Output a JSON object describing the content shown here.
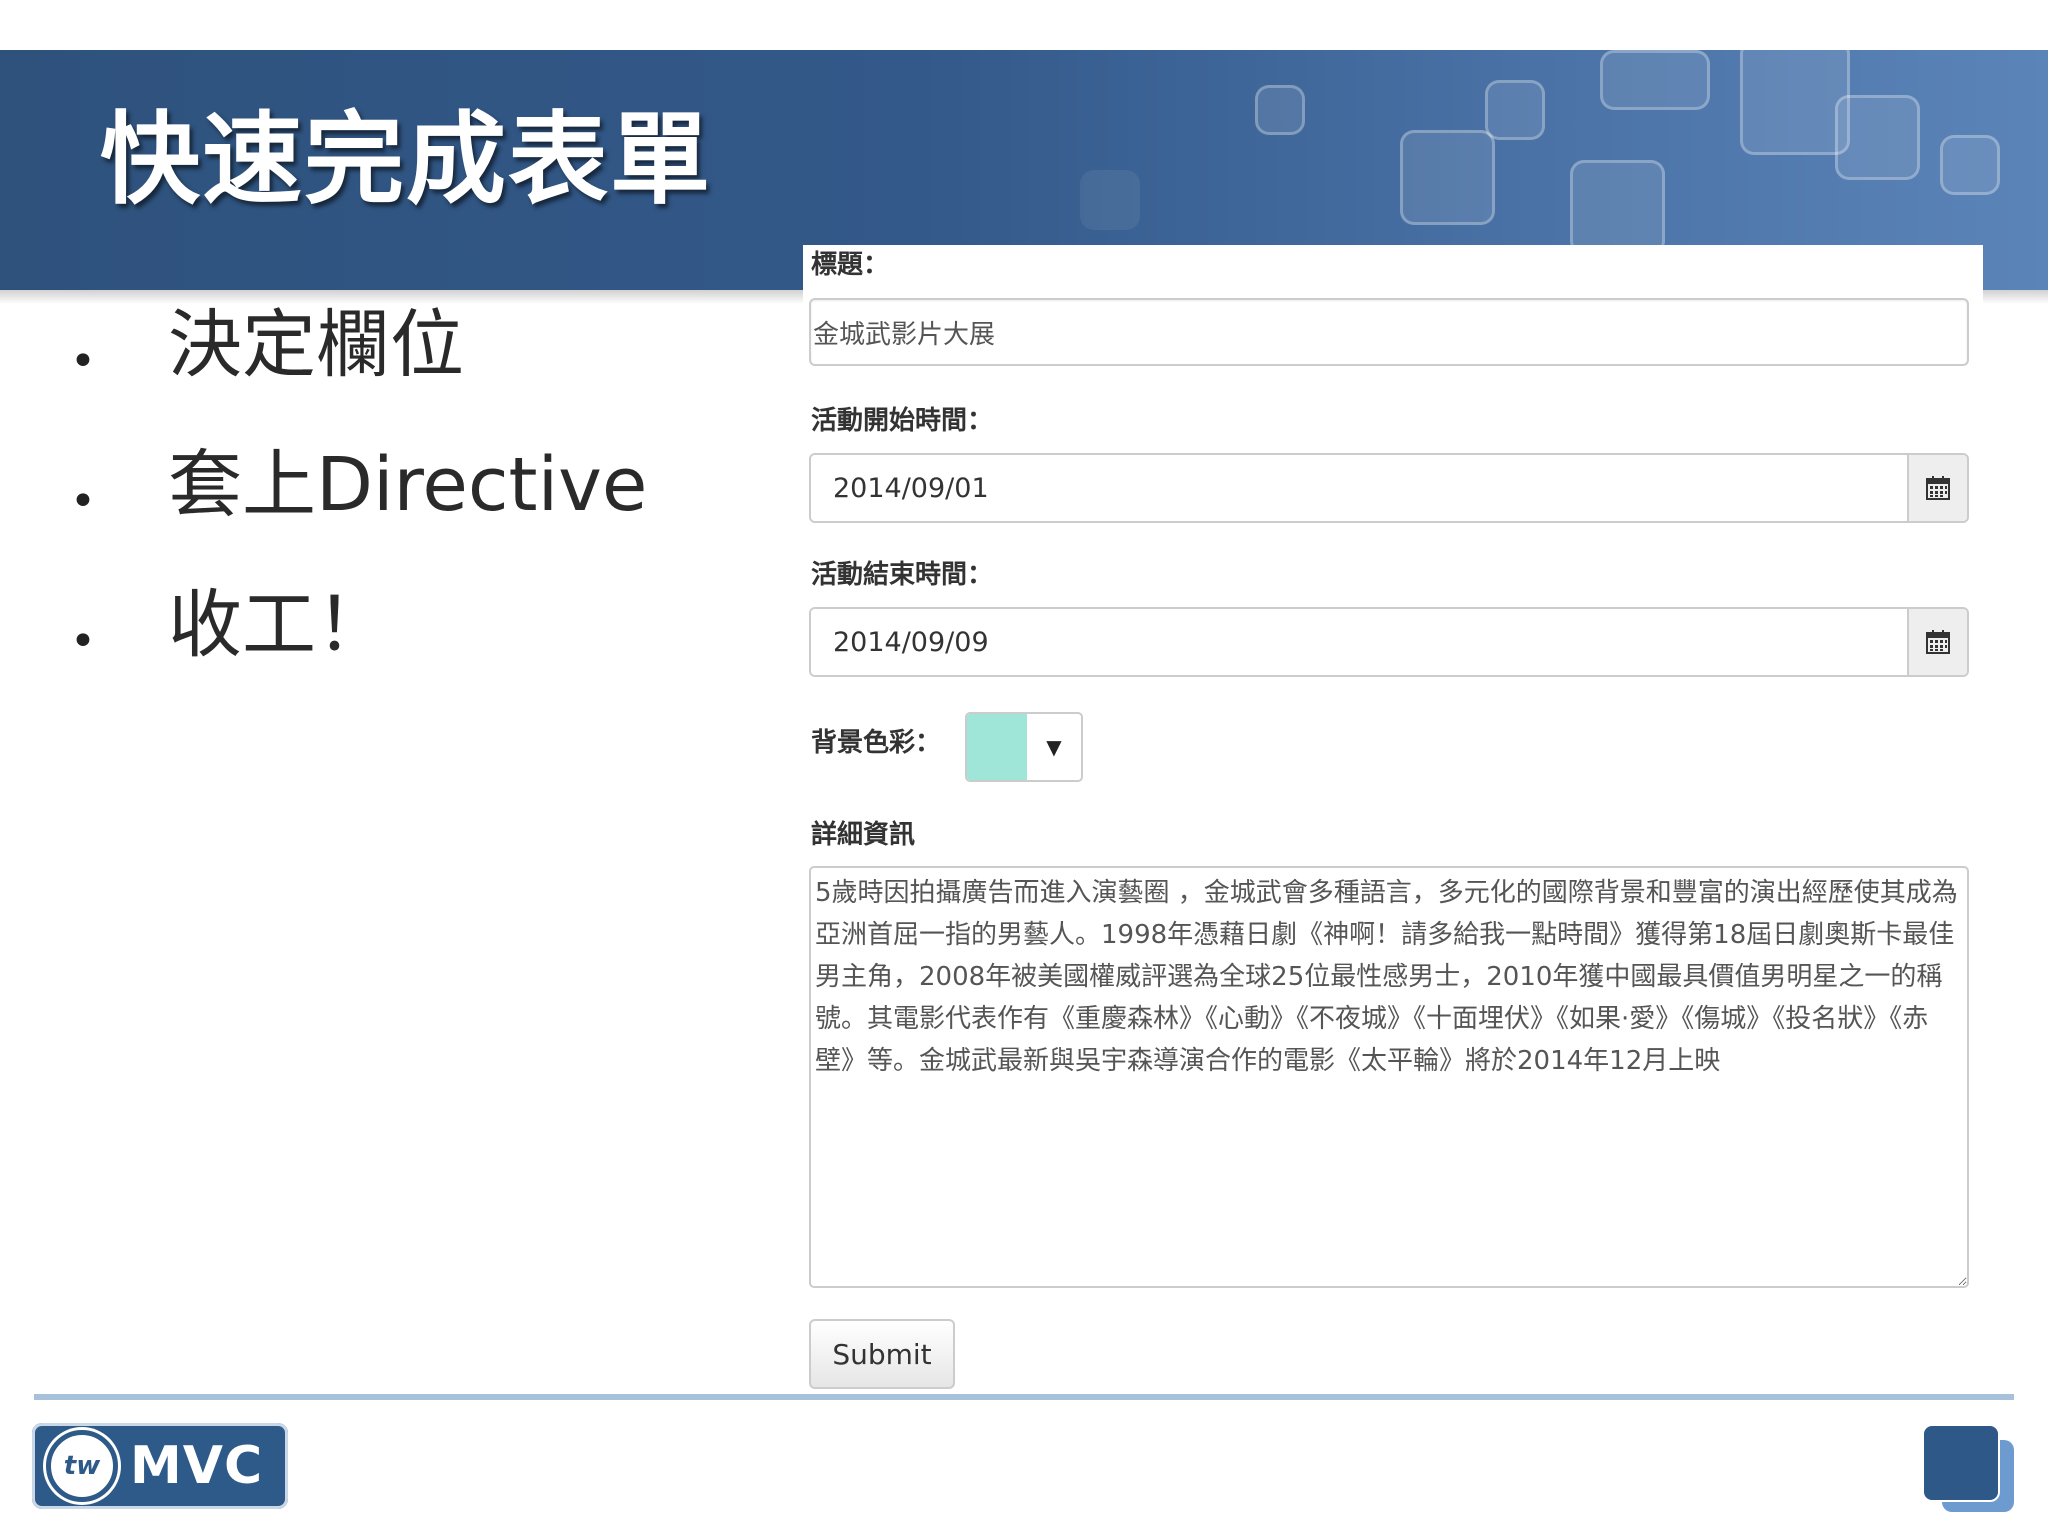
{
  "slide": {
    "title": "快速完成表單",
    "bullets": [
      "決定欄位",
      "套上Directive",
      "收工！"
    ]
  },
  "form": {
    "title_label": "標題：",
    "title_value": "金城武影片大展",
    "start_label": "活動開始時間：",
    "start_value": "2014/09/01",
    "end_label": "活動結束時間：",
    "end_value": "2014/09/09",
    "color_label": "背景色彩：",
    "color_value": "#9fe5d8",
    "details_label": "詳細資訊",
    "details_value": "5歲時因拍攝廣告而進入演藝圈 ，金城武會多種語言，多元化的國際背景和豐富的演出經歷使其成為亞洲首屈一指的男藝人。1998年憑藉日劇《神啊！請多給我一點時間》獲得第18屆日劇奧斯卡最佳男主角，2008年被美國權威評選為全球25位最性感男士，2010年獲中國最具價值男明星之一的稱號。其電影代表作有《重慶森林》《心動》《不夜城》《十面埋伏》《如果·愛》《傷城》《投名狀》《赤壁》等。金城武最新與吳宇森導演合作的電影《太平輪》將於2014年12月上映",
    "submit_label": "Submit"
  },
  "footer": {
    "logo_badge": "tw",
    "logo_text": "MVC"
  },
  "colors": {
    "header_blue": "#2e527c",
    "accent_square": "#2e5888"
  }
}
